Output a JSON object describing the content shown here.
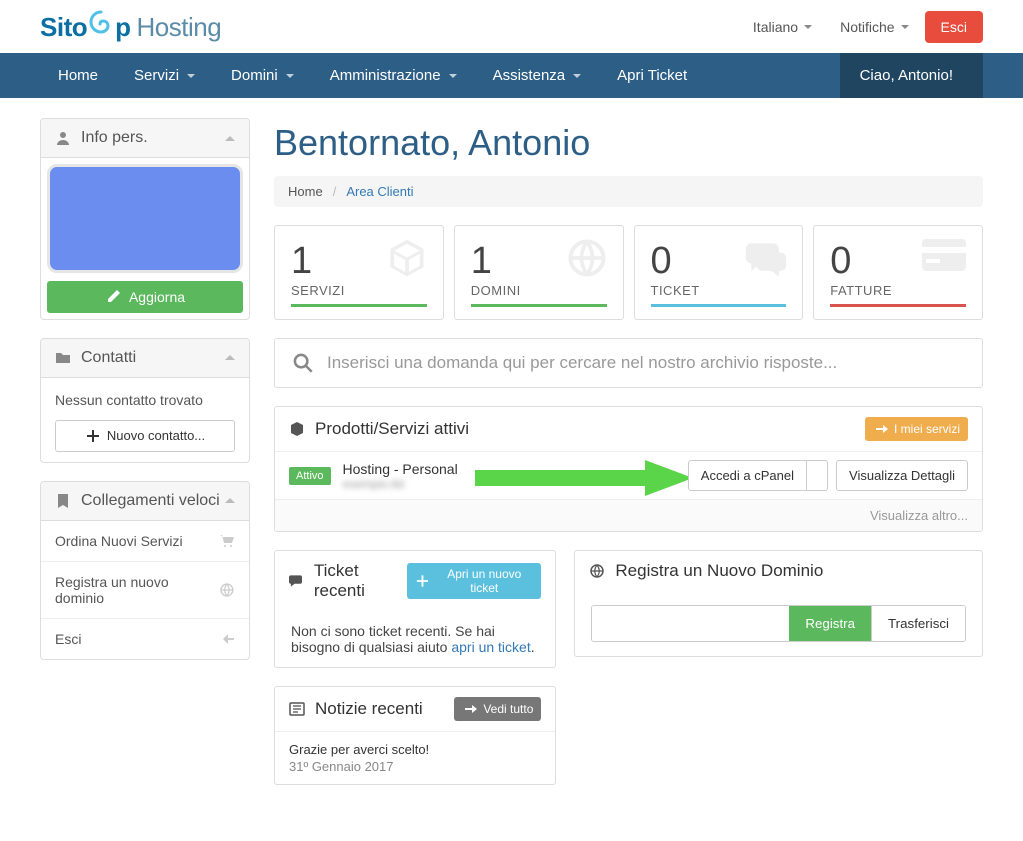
{
  "topbar": {
    "logo_sito": "Sito",
    "logo_p": "p",
    "logo_hosting": "Hosting",
    "language": "Italiano",
    "notifications": "Notifiche",
    "logout": "Esci"
  },
  "nav": {
    "home": "Home",
    "services": "Servizi",
    "domains": "Domini",
    "admin": "Amministrazione",
    "support": "Assistenza",
    "open_ticket": "Apri Ticket",
    "user_greeting": "Ciao, Antonio!"
  },
  "welcome": "Bentornato, Antonio",
  "breadcrumb": {
    "home": "Home",
    "current": "Area Clienti"
  },
  "stats": {
    "services_value": "1",
    "services_label": "SERVIZI",
    "domains_value": "1",
    "domains_label": "DOMINI",
    "tickets_value": "0",
    "tickets_label": "TICKET",
    "invoices_value": "0",
    "invoices_label": "FATTURE"
  },
  "search": {
    "placeholder": "Inserisci una domanda qui per cercare nel nostro archivio risposte..."
  },
  "sidebar": {
    "info_title": "Info pers.",
    "update_btn": "Aggiorna",
    "contacts_title": "Contatti",
    "contacts_empty": "Nessun contatto trovato",
    "new_contact_btn": "Nuovo contatto...",
    "quicklinks_title": "Collegamenti veloci",
    "order": "Ordina Nuovi Servizi",
    "register_domain": "Registra un nuovo dominio",
    "logout": "Esci"
  },
  "products": {
    "title": "Prodotti/Servizi attivi",
    "my_services": "I miei servizi",
    "active_badge": "Attivo",
    "name": "Hosting - Personal",
    "sub": "esempio.tld",
    "cpanel": "Accedi a cPanel",
    "details": "Visualizza Dettagli",
    "more": "Visualizza altro..."
  },
  "tickets": {
    "title": "Ticket recenti",
    "open_new": "Apri un nuovo ticket",
    "empty_1": "Non ci sono ticket recenti. Se hai bisogno di qualsiasi aiuto ",
    "empty_link": "apri un ticket",
    "empty_2": "."
  },
  "domain_reg": {
    "title": "Registra un Nuovo Dominio",
    "register": "Registra",
    "transfer": "Trasferisci"
  },
  "news": {
    "title": "Notizie recenti",
    "view_all": "Vedi tutto",
    "item_title": "Grazie per averci scelto!",
    "item_date": "31º Gennaio 2017"
  }
}
